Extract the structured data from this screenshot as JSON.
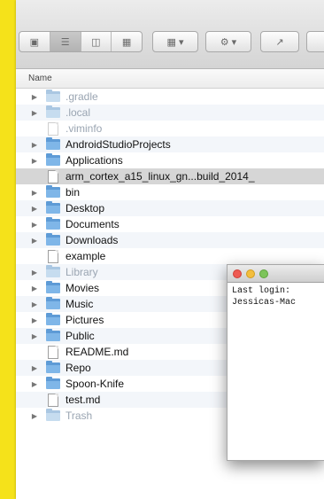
{
  "toolbar": {
    "view_icon": "icon-view-icon",
    "view_list": "list-view-icon",
    "view_columns": "columns-view-icon",
    "view_coverflow": "coverflow-view-icon",
    "arrange": "arrange-icon",
    "action": "gear-icon",
    "share": "share-icon"
  },
  "columns": {
    "name": "Name"
  },
  "files": [
    {
      "name": ".gradle",
      "type": "folder",
      "expandable": true,
      "hidden": true
    },
    {
      "name": ".local",
      "type": "folder",
      "expandable": true,
      "hidden": true
    },
    {
      "name": ".viminfo",
      "type": "file",
      "expandable": false,
      "hidden": true
    },
    {
      "name": "AndroidStudioProjects",
      "type": "folder",
      "expandable": true,
      "hidden": false
    },
    {
      "name": "Applications",
      "type": "folder",
      "expandable": true,
      "hidden": false
    },
    {
      "name": "arm_cortex_a15_linux_gn...build_2014_",
      "type": "file",
      "expandable": false,
      "hidden": false,
      "selected": true
    },
    {
      "name": "bin",
      "type": "folder",
      "expandable": true,
      "hidden": false
    },
    {
      "name": "Desktop",
      "type": "folder",
      "expandable": true,
      "hidden": false
    },
    {
      "name": "Documents",
      "type": "folder",
      "expandable": true,
      "hidden": false
    },
    {
      "name": "Downloads",
      "type": "folder",
      "expandable": true,
      "hidden": false
    },
    {
      "name": "example",
      "type": "file",
      "expandable": false,
      "hidden": false
    },
    {
      "name": "Library",
      "type": "folder",
      "expandable": true,
      "hidden": true
    },
    {
      "name": "Movies",
      "type": "folder",
      "expandable": true,
      "hidden": false
    },
    {
      "name": "Music",
      "type": "folder",
      "expandable": true,
      "hidden": false
    },
    {
      "name": "Pictures",
      "type": "folder",
      "expandable": true,
      "hidden": false
    },
    {
      "name": "Public",
      "type": "folder",
      "expandable": true,
      "hidden": false
    },
    {
      "name": "README.md",
      "type": "file",
      "expandable": false,
      "hidden": false
    },
    {
      "name": "Repo",
      "type": "folder",
      "expandable": true,
      "hidden": false
    },
    {
      "name": "Spoon-Knife",
      "type": "folder",
      "expandable": true,
      "hidden": false
    },
    {
      "name": "test.md",
      "type": "file",
      "expandable": false,
      "hidden": false
    },
    {
      "name": "Trash",
      "type": "folder",
      "expandable": true,
      "hidden": true
    }
  ],
  "terminal": {
    "line1": "Last login: ",
    "line2": "Jessicas-Mac"
  },
  "colors": {
    "background": "#f5e21a",
    "folder": "#7fb6e8",
    "selection": "#d6d6d6"
  }
}
